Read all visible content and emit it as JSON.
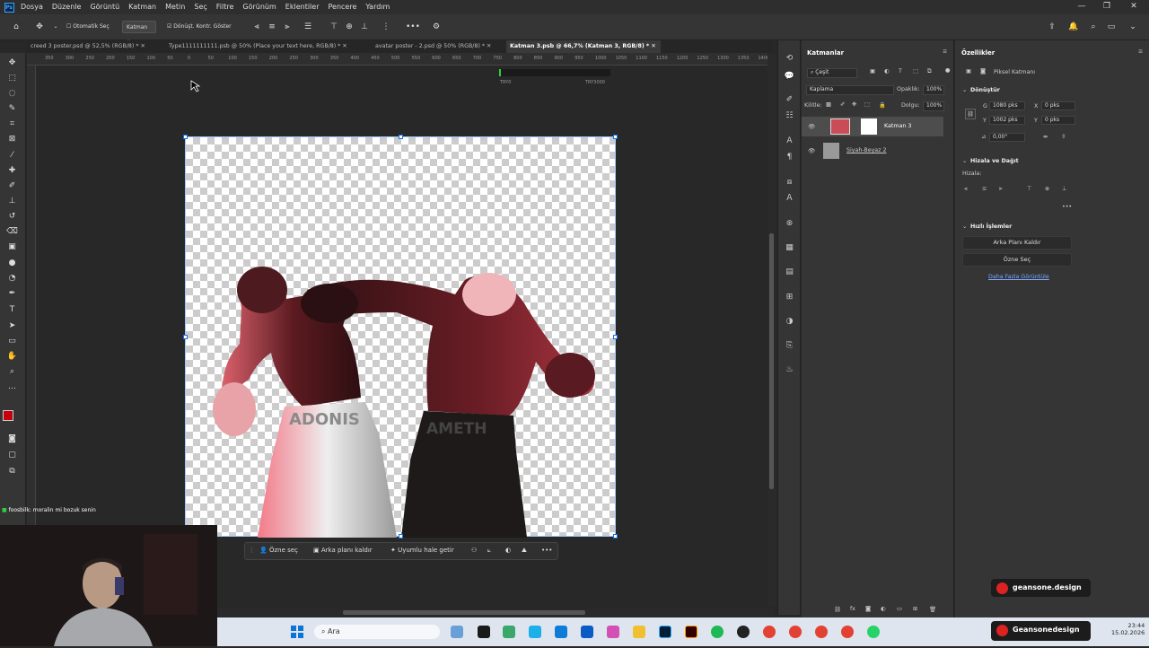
{
  "menu": [
    "Dosya",
    "Düzenle",
    "Görüntü",
    "Katman",
    "Metin",
    "Seç",
    "Filtre",
    "Görünüm",
    "Eklentiler",
    "Pencere",
    "Yardım"
  ],
  "options": {
    "auto_select": "Otomatik Seç",
    "layer_select": "Katman",
    "transform_controls": "Dönüşt. Kontr. Göster"
  },
  "tabs": [
    "creed 3 poster.psd @ 52,5% (RGB/8) *",
    "Type1111111111.psb @ 50% (Place your text here, RGB/8) *",
    "avatar poster - 2.psd @ 50% (RGB/8) *",
    "Katman 3.psb @ 66,7% (Katman 3, RGB/8) *"
  ],
  "ruler": {
    "numbers": [
      "350",
      "300",
      "250",
      "200",
      "150",
      "100",
      "50",
      "0",
      "50",
      "100",
      "150",
      "200",
      "250",
      "300",
      "350",
      "400",
      "450",
      "500",
      "550",
      "600",
      "650",
      "700",
      "750",
      "800",
      "850",
      "900",
      "950",
      "1000",
      "1050",
      "1100",
      "1150",
      "1200",
      "1250",
      "1300",
      "1350",
      "1400"
    ]
  },
  "canvas_top": {
    "left": "TRY0",
    "right": "TRY3000"
  },
  "artwork": {
    "left_trunks": "ADONIS",
    "right_trunks": "AMETH"
  },
  "context_bar": {
    "select_subject": "Özne seç",
    "remove_bg": "Arka planı kaldır",
    "generative_fill": "Uyumlu hale getir"
  },
  "layers": {
    "title": "Katmanlar",
    "filter": "Çeşit",
    "blend": "Kaplama",
    "opacity_label": "Opaklık:",
    "opacity": "100%",
    "lock_label": "Kilitle:",
    "fill_label": "Dolgu:",
    "fill": "100%",
    "items": [
      "Katman 3",
      "Siyah-Beyaz 2"
    ]
  },
  "properties": {
    "title": "Özellikler",
    "pixel_layer": "Piksel Katmanı",
    "transform_title": "Dönüştür",
    "w": "1080 pks",
    "h": "1002 pks",
    "x": "0 pks",
    "y": "0 pks",
    "angle": "0,00°",
    "align_title": "Hizala ve Dağıt",
    "align_label": "Hizala:",
    "quick_title": "Hızlı İşlemler",
    "remove_bg": "Arka Planı Kaldır",
    "select_subject": "Özne Seç",
    "more": "Daha Fazla Görüntüle"
  },
  "chat": {
    "user": "foosbilk:",
    "msg": "moralin mi bozuk senin"
  },
  "overlay": {
    "brand1": "geansone.design",
    "brand2": "Geansonedesign"
  },
  "taskbar": {
    "search": "Ara",
    "time": "23:44",
    "date": "15.02.2026"
  }
}
